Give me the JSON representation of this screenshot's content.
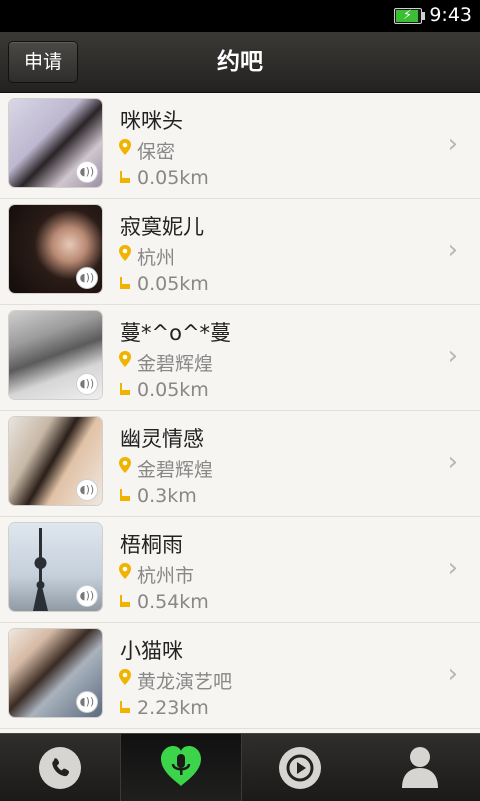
{
  "status": {
    "time": "9:43"
  },
  "header": {
    "apply_label": "申请",
    "title": "约吧"
  },
  "list": [
    {
      "name": "咪咪头",
      "location": "保密",
      "distance": "0.05km"
    },
    {
      "name": "寂寞妮儿",
      "location": "杭州",
      "distance": "0.05km"
    },
    {
      "name": "蔓*^o^*蔓",
      "location": "金碧辉煌",
      "distance": "0.05km"
    },
    {
      "name": "幽灵情感",
      "location": "金碧辉煌",
      "distance": "0.3km"
    },
    {
      "name": "梧桐雨",
      "location": "杭州市",
      "distance": "0.54km"
    },
    {
      "name": "小猫咪",
      "location": "黄龙演艺吧",
      "distance": "2.23km"
    }
  ],
  "tabs": [
    {
      "icon": "phone-icon"
    },
    {
      "icon": "heart-mic-icon",
      "active": true
    },
    {
      "icon": "play-icon"
    },
    {
      "icon": "person-icon"
    }
  ],
  "colors": {
    "accent_green": "#3bd44a",
    "pin_yellow": "#f0b400"
  }
}
